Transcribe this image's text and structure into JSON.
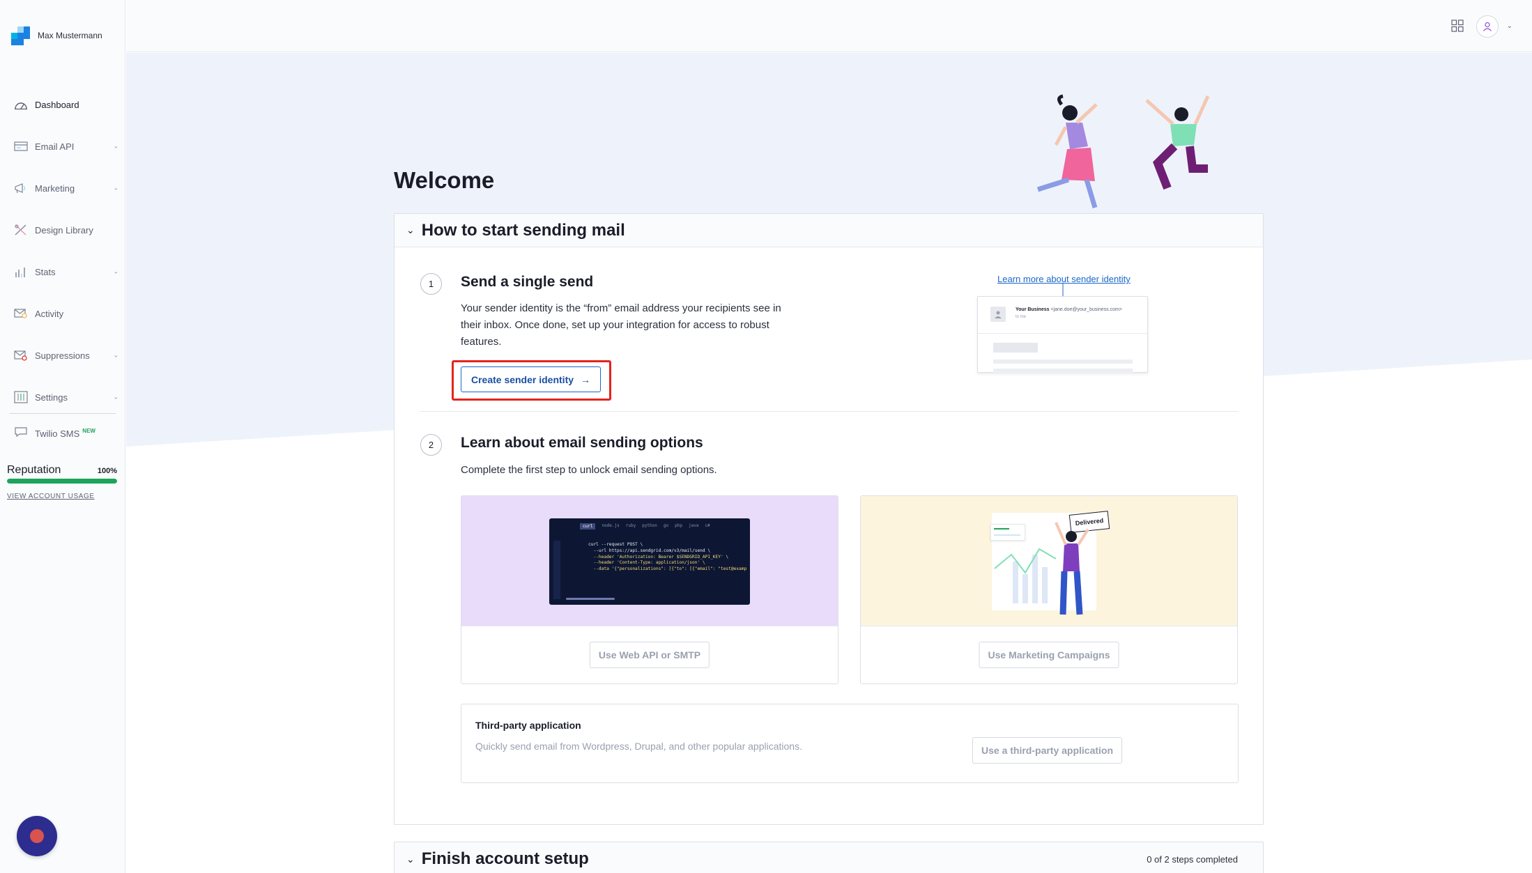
{
  "app": {
    "account_name": "Max Mustermann"
  },
  "sidebar": {
    "items": [
      {
        "label": "Dashboard",
        "icon": "gauge-icon",
        "active": true,
        "expandable": false
      },
      {
        "label": "Email API",
        "icon": "envelope-code-icon",
        "expandable": true
      },
      {
        "label": "Marketing",
        "icon": "megaphone-icon",
        "expandable": true
      },
      {
        "label": "Design Library",
        "icon": "design-tools-icon",
        "expandable": false
      },
      {
        "label": "Stats",
        "icon": "bar-chart-icon",
        "expandable": true
      },
      {
        "label": "Activity",
        "icon": "mail-search-icon",
        "expandable": false
      },
      {
        "label": "Suppressions",
        "icon": "mail-block-icon",
        "expandable": true
      },
      {
        "label": "Settings",
        "icon": "sliders-icon",
        "expandable": true
      }
    ],
    "twilio": {
      "label": "Twilio SMS",
      "badge": "NEW",
      "icon": "chat-bubble-icon"
    },
    "reputation": {
      "label": "Reputation",
      "value_text": "100%",
      "percent": 100
    },
    "usage_link": "VIEW ACCOUNT USAGE"
  },
  "main": {
    "welcome": "Welcome",
    "section1": {
      "title": "How to start sending mail",
      "step1": {
        "number": "1",
        "title": "Send a single send",
        "description": "Your sender identity is the “from” email address your recipients see in their inbox. Once done, set up your integration for access to robust features.",
        "button": "Create sender identity",
        "learn_link": "Learn more about sender identity",
        "preview": {
          "sender": "Your Business",
          "address": "<jane.doe@your_business.com>",
          "to": "to me"
        }
      },
      "step2": {
        "number": "2",
        "title": "Learn about email sending options",
        "description": "Complete the first step to unlock email sending options.",
        "code_tabs": [
          "curl",
          "node.js",
          "ruby",
          "python",
          "go",
          "php",
          "java",
          "c#"
        ],
        "code_lines": [
          "curl --request POST \\",
          "--url https://api.sendgrid.com/v3/mail/send \\",
          "--header 'Authorization: Bearer $SENDGRID_API_KEY' \\",
          "--header 'Content-Type: application/json' \\",
          "--data '{\"personalizations\": [{\"to\": [{\"email\": \"test@examp"
        ],
        "delivered_label": "Delivered",
        "option_api": "Use Web API or SMTP",
        "option_marketing": "Use Marketing Campaigns",
        "third_party": {
          "title": "Third-party application",
          "description": "Quickly send email from Wordpress, Drupal, and other popular applications.",
          "button": "Use a third-party application"
        }
      }
    },
    "section2": {
      "title": "Finish account setup",
      "progress": "0 of 2 steps completed"
    }
  },
  "colors": {
    "accent": "#1a67c9",
    "success": "#1fa35c",
    "highlight": "#e3241b",
    "api_bg": "#e9dcfb",
    "marketing_bg": "#fdf4de",
    "chat": "#2d2c8f"
  }
}
